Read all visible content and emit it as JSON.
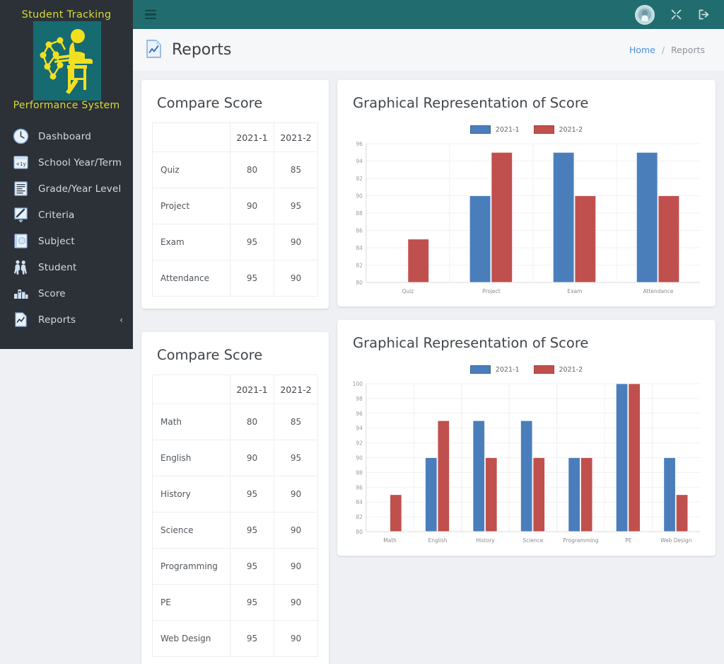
{
  "brand": {
    "title": "Student Tracking",
    "subtitle": "Performance System",
    "logo_icon": "student-at-desk-logo"
  },
  "sidebar": {
    "items": [
      {
        "label": "Dashboard",
        "icon": "dashboard-icon"
      },
      {
        "label": "School Year/Term",
        "icon": "calendar-year-icon"
      },
      {
        "label": "Grade/Year Level",
        "icon": "grade-level-icon"
      },
      {
        "label": "Criteria",
        "icon": "criteria-pencil-icon"
      },
      {
        "label": "Subject",
        "icon": "book-icon"
      },
      {
        "label": "Student",
        "icon": "students-icon"
      },
      {
        "label": "Score",
        "icon": "score-bars-icon"
      },
      {
        "label": "Reports",
        "icon": "report-document-icon",
        "caret": "‹"
      }
    ]
  },
  "topbar": {
    "menu_icon": "hamburger-icon",
    "avatar_icon": "user-avatar-icon",
    "fullscreen_icon": "fullscreen-icon",
    "logout_icon": "logout-icon",
    "color": "#216c6e"
  },
  "page": {
    "title": "Reports",
    "title_icon": "report-document-icon",
    "breadcrumb": {
      "home": "Home",
      "separator": "/",
      "current": "Reports"
    }
  },
  "cards": {
    "compare_criteria": {
      "title": "Compare Score",
      "columns": [
        "",
        "2021-1",
        "2021-2"
      ],
      "rows": [
        {
          "label": "Quiz",
          "v1": "80",
          "v2": "85"
        },
        {
          "label": "Project",
          "v1": "90",
          "v2": "95"
        },
        {
          "label": "Exam",
          "v1": "95",
          "v2": "90"
        },
        {
          "label": "Attendance",
          "v1": "95",
          "v2": "90"
        }
      ]
    },
    "compare_subject": {
      "title": "Compare Score",
      "columns": [
        "",
        "2021-1",
        "2021-2"
      ],
      "rows": [
        {
          "label": "Math",
          "v1": "80",
          "v2": "85"
        },
        {
          "label": "English",
          "v1": "90",
          "v2": "95"
        },
        {
          "label": "History",
          "v1": "95",
          "v2": "90"
        },
        {
          "label": "Science",
          "v1": "95",
          "v2": "90"
        },
        {
          "label": "Programming",
          "v1": "95",
          "v2": "90"
        },
        {
          "label": "PE",
          "v1": "95",
          "v2": "90"
        },
        {
          "label": "Web Design",
          "v1": "95",
          "v2": "90"
        }
      ]
    },
    "chart_criteria": {
      "title": "Graphical Representation of Score"
    },
    "chart_subject": {
      "title": "Graphical Representation of Score"
    }
  },
  "chart_data": [
    {
      "id": "criteria-chart",
      "type": "bar",
      "title": "Graphical Representation of Score",
      "categories": [
        "Quiz",
        "Project",
        "Exam",
        "Attendance"
      ],
      "series": [
        {
          "name": "2021-1",
          "color": "#4a7ebb",
          "values": [
            80,
            90,
            95,
            95
          ]
        },
        {
          "name": "2021-2",
          "color": "#c0504d",
          "values": [
            85,
            95,
            90,
            90
          ]
        }
      ],
      "ylim": [
        80,
        96
      ],
      "yticks": [
        80,
        82,
        84,
        86,
        88,
        90,
        92,
        94,
        96
      ],
      "xlabel": "",
      "ylabel": "",
      "grid": true,
      "legend_position": "top"
    },
    {
      "id": "subject-chart",
      "type": "bar",
      "title": "Graphical Representation of Score",
      "categories": [
        "Math",
        "English",
        "History",
        "Science",
        "Programming",
        "PE",
        "Web Design"
      ],
      "series": [
        {
          "name": "2021-1",
          "color": "#4a7ebb",
          "values": [
            80,
            90,
            95,
            95,
            90,
            100,
            90
          ]
        },
        {
          "name": "2021-2",
          "color": "#c0504d",
          "values": [
            85,
            95,
            90,
            90,
            90,
            100,
            85
          ]
        }
      ],
      "ylim": [
        80,
        100
      ],
      "yticks": [
        80,
        82,
        84,
        86,
        88,
        90,
        92,
        94,
        96,
        98,
        100
      ],
      "xlabel": "",
      "ylabel": "",
      "grid": true,
      "legend_position": "top"
    }
  ]
}
